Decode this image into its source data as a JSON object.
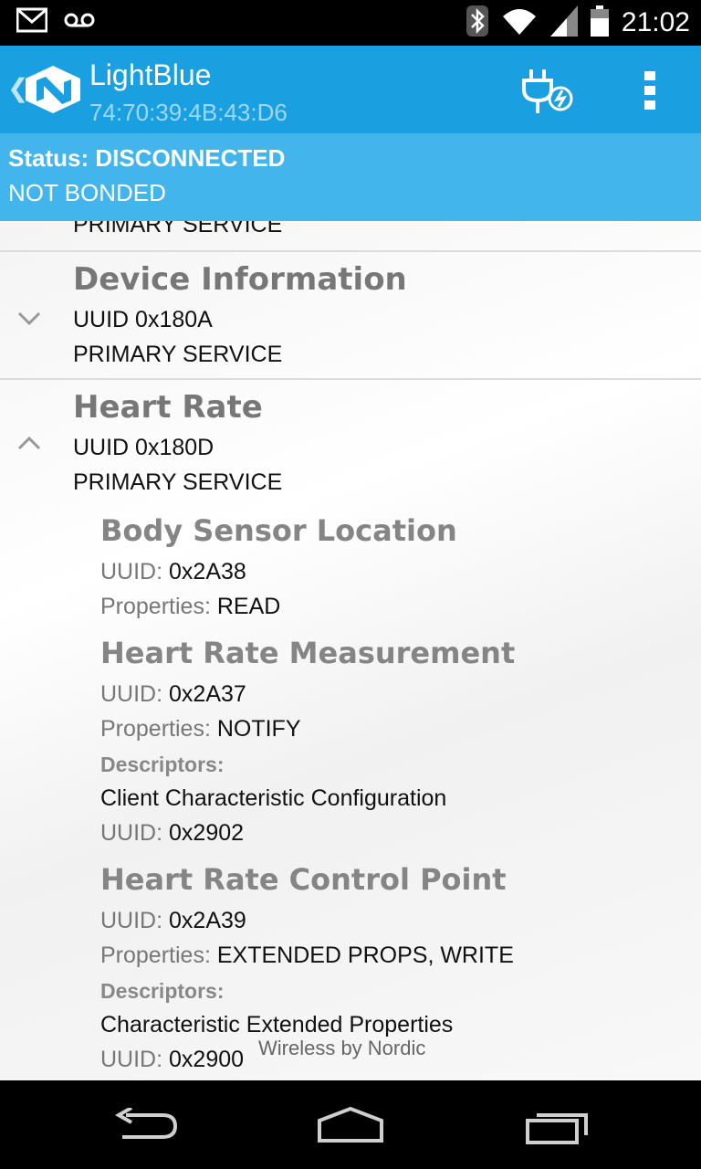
{
  "statusbar": {
    "time": "21:02",
    "icons": [
      "gmail-icon",
      "voicemail-icon",
      "bluetooth-icon",
      "wifi-icon",
      "signal-icon",
      "battery-icon"
    ]
  },
  "actionbar": {
    "title": "LightBlue",
    "subtitle": "74:70:39:4B:43:D6",
    "brand_color": "#1aa0e0"
  },
  "banner": {
    "status": "Status: DISCONNECTED",
    "bond": "NOT BONDED",
    "color": "#41b5ec"
  },
  "partial_top": "PRIMARY SERVICE",
  "services": [
    {
      "name": "Device Information",
      "uuid": "UUID  0x180A",
      "type": "PRIMARY SERVICE",
      "expanded": false
    },
    {
      "name": "Heart Rate",
      "uuid": "UUID  0x180D",
      "type": "PRIMARY SERVICE",
      "expanded": true
    }
  ],
  "labels": {
    "uuid": "UUID:",
    "properties": "Properties:",
    "descriptors": "Descriptors:"
  },
  "characteristics": [
    {
      "name": "Body Sensor Location",
      "uuid": "0x2A38",
      "properties": "READ"
    },
    {
      "name": "Heart Rate Measurement",
      "uuid": "0x2A37",
      "properties": "NOTIFY",
      "descriptor_name": "Client Characteristic Configuration",
      "descriptor_uuid": "0x2902"
    },
    {
      "name": "Heart Rate Control Point",
      "uuid": "0x2A39",
      "properties": "EXTENDED PROPS, WRITE",
      "descriptor_name": "Characteristic Extended Properties",
      "descriptor_uuid": "0x2900"
    }
  ],
  "watermark": "Wireless by Nordic",
  "navbar": {
    "icons": [
      "back-icon",
      "home-icon",
      "recent-apps-icon"
    ]
  }
}
